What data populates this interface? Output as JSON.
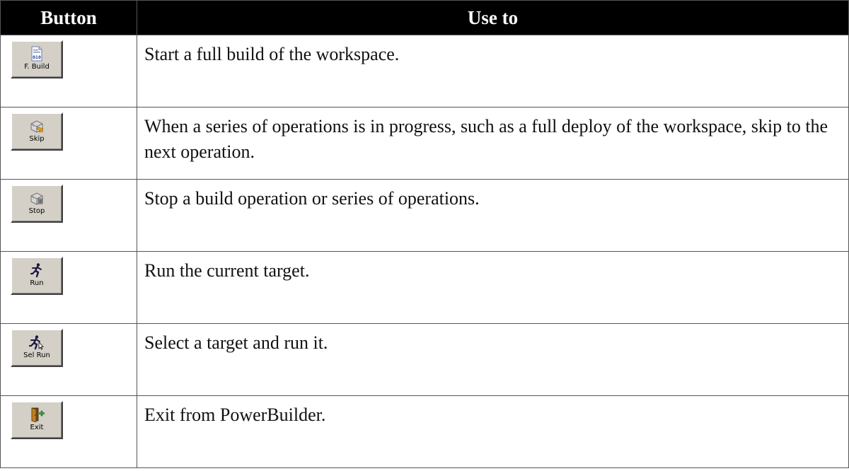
{
  "table": {
    "headers": {
      "button": "Button",
      "use_to": "Use to"
    },
    "rows": [
      {
        "button_label": "F. Build",
        "icon": "full-build-icon",
        "description": "Start a full build of the workspace."
      },
      {
        "button_label": "Skip",
        "icon": "skip-icon",
        "description": "When a series of operations is in progress, such as a full deploy of the workspace, skip to the next operation."
      },
      {
        "button_label": "Stop",
        "icon": "stop-icon",
        "description": "Stop a build operation or series of operations."
      },
      {
        "button_label": "Run",
        "icon": "run-icon",
        "description": "Run the current target."
      },
      {
        "button_label": "Sel Run",
        "icon": "select-run-icon",
        "description": "Select a target and run it."
      },
      {
        "button_label": "Exit",
        "icon": "exit-icon",
        "description": "Exit from PowerBuilder."
      }
    ]
  }
}
